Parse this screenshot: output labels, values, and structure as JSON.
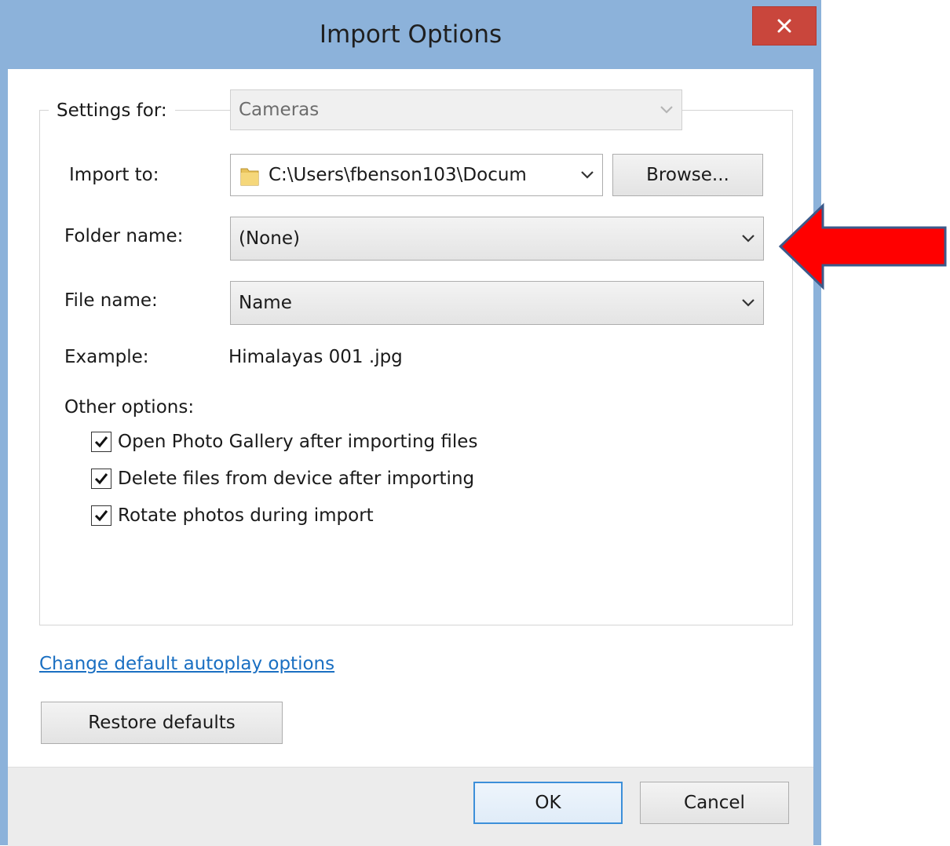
{
  "window": {
    "title": "Import Options",
    "close_glyph": "✕"
  },
  "settings_for": {
    "label": "Settings for:",
    "value": "Cameras"
  },
  "import_to": {
    "label": "Import to:",
    "value": "C:\\Users\\fbenson103\\Docum",
    "browse_label": "Browse..."
  },
  "folder_name": {
    "label": "Folder name:",
    "value": "(None)"
  },
  "file_name": {
    "label": "File name:",
    "value": "Name"
  },
  "example": {
    "label": "Example:",
    "value": "Himalayas 001 .jpg"
  },
  "other_options": {
    "label": "Other options:",
    "items": [
      {
        "label": "Open Photo Gallery after importing files",
        "checked": true
      },
      {
        "label": "Delete files from device after importing",
        "checked": true
      },
      {
        "label": "Rotate photos during import",
        "checked": true
      }
    ]
  },
  "links": {
    "autoplay": "Change default autoplay options"
  },
  "buttons": {
    "restore": "Restore defaults",
    "ok": "OK",
    "cancel": "Cancel"
  },
  "icons": {
    "close": "close-icon",
    "chevron": "chevron-down-icon",
    "folder": "folder-icon",
    "check": "checkmark-icon",
    "arrow": "arrow-left-icon"
  },
  "colors": {
    "title_bar": "#8cb2da",
    "close_button": "#c9463c",
    "link": "#1a6fc2",
    "annotation_arrow": "#ff0000",
    "annotation_outline": "#3c5a8a"
  }
}
